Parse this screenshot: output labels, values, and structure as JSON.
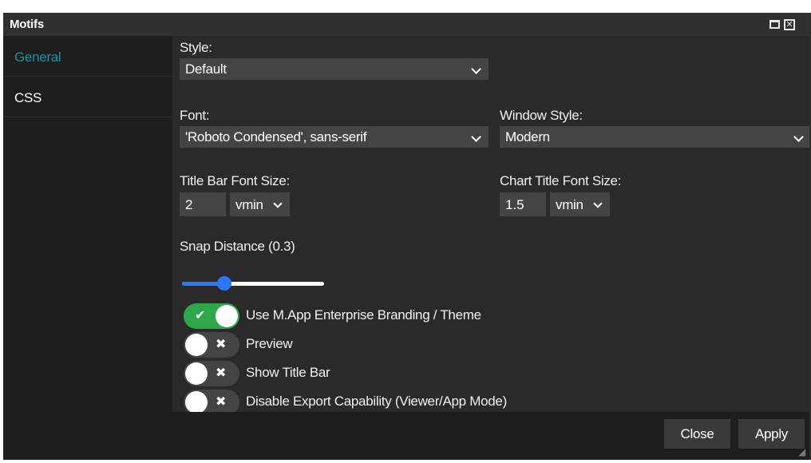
{
  "window": {
    "title": "Motifs",
    "maximize_icon": "maximize-icon",
    "close_icon": "close-icon",
    "close_glyph": "✕"
  },
  "sidebar": {
    "items": [
      {
        "label": "General",
        "active": true
      },
      {
        "label": "CSS",
        "active": false
      }
    ]
  },
  "form": {
    "style": {
      "label": "Style:",
      "value": "Default"
    },
    "font": {
      "label": "Font:",
      "value": "'Roboto Condensed', sans-serif"
    },
    "window_style": {
      "label": "Window Style:",
      "value": "Modern"
    },
    "title_bar_font_size": {
      "label": "Title Bar Font Size:",
      "value": "2",
      "unit": "vmin"
    },
    "chart_title_font_size": {
      "label": "Chart Title Font Size:",
      "value": "1.5",
      "unit": "vmin"
    },
    "snap_distance": {
      "label": "Snap Distance (0.3)",
      "value": 0.3,
      "min": 0,
      "max": 1
    }
  },
  "toggles": [
    {
      "label": "Use M.App Enterprise Branding / Theme",
      "on": true
    },
    {
      "label": "Preview",
      "on": false
    },
    {
      "label": "Show Title Bar",
      "on": false
    },
    {
      "label": "Disable Export Capability (Viewer/App Mode)",
      "on": false
    }
  ],
  "footer": {
    "close_label": "Close",
    "apply_label": "Apply"
  },
  "colors": {
    "accent": "#1e8fa0",
    "toggle_on": "#2ea64a",
    "slider": "#2979ff"
  }
}
